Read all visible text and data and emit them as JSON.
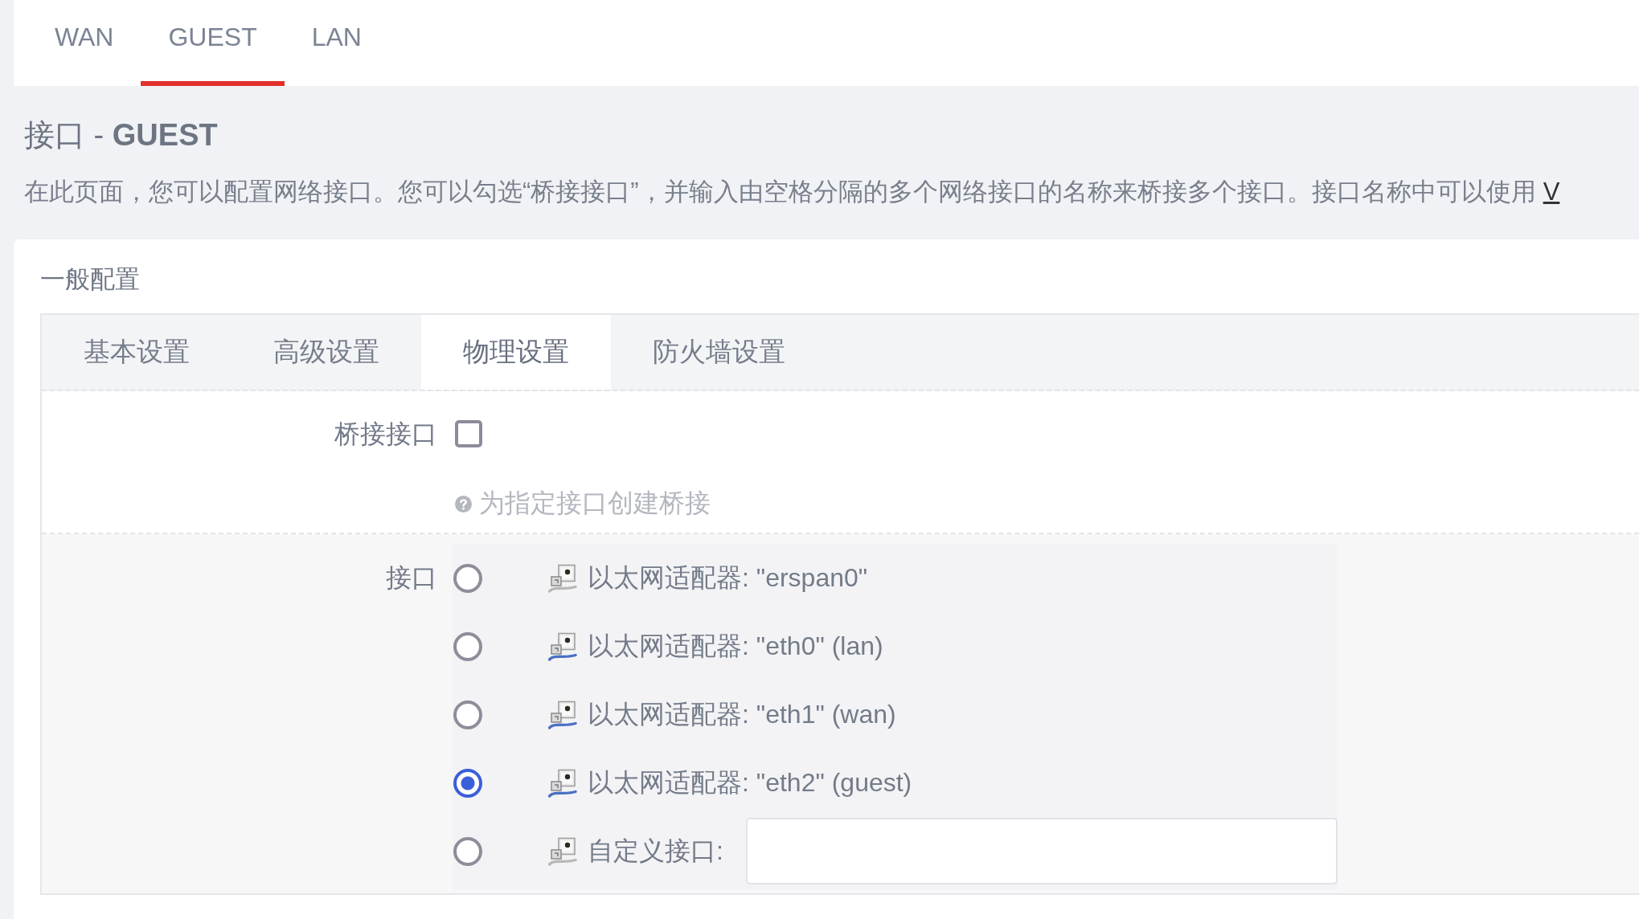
{
  "top_tabs": [
    {
      "label": "WAN",
      "selected": false
    },
    {
      "label": "GUEST",
      "selected": true
    },
    {
      "label": "LAN",
      "selected": false
    }
  ],
  "page": {
    "title": "接口 - **GUEST**",
    "description": "在此页面，您可以配置网络接口。您可以勾选“桥接接口”，并输入由空格分隔的多个网络接口的名称来桥接多个接口。接口名称中可以使用",
    "description_link": "V"
  },
  "section": {
    "title": "一般配置",
    "tabs": [
      {
        "label": "基本设置",
        "selected": false
      },
      {
        "label": "高级设置",
        "selected": false
      },
      {
        "label": "物理设置",
        "selected": true
      },
      {
        "label": "防火墙设置",
        "selected": false
      }
    ],
    "bridge": {
      "label": "桥接接口",
      "checked": false,
      "help": "为指定接口创建桥接"
    },
    "interface": {
      "label": "接口",
      "options": [
        {
          "kind": "adapter",
          "label": "以太网适配器: \"erspan0\"",
          "selected": false,
          "linked": false
        },
        {
          "kind": "adapter",
          "label": "以太网适配器: \"eth0\" (lan)",
          "selected": false,
          "linked": true
        },
        {
          "kind": "adapter",
          "label": "以太网适配器: \"eth1\" (wan)",
          "selected": false,
          "linked": true
        },
        {
          "kind": "adapter",
          "label": "以太网适配器: \"eth2\" (guest)",
          "selected": true,
          "linked": true
        },
        {
          "kind": "custom",
          "label": "自定义接口:",
          "selected": false,
          "linked": false
        }
      ]
    }
  }
}
